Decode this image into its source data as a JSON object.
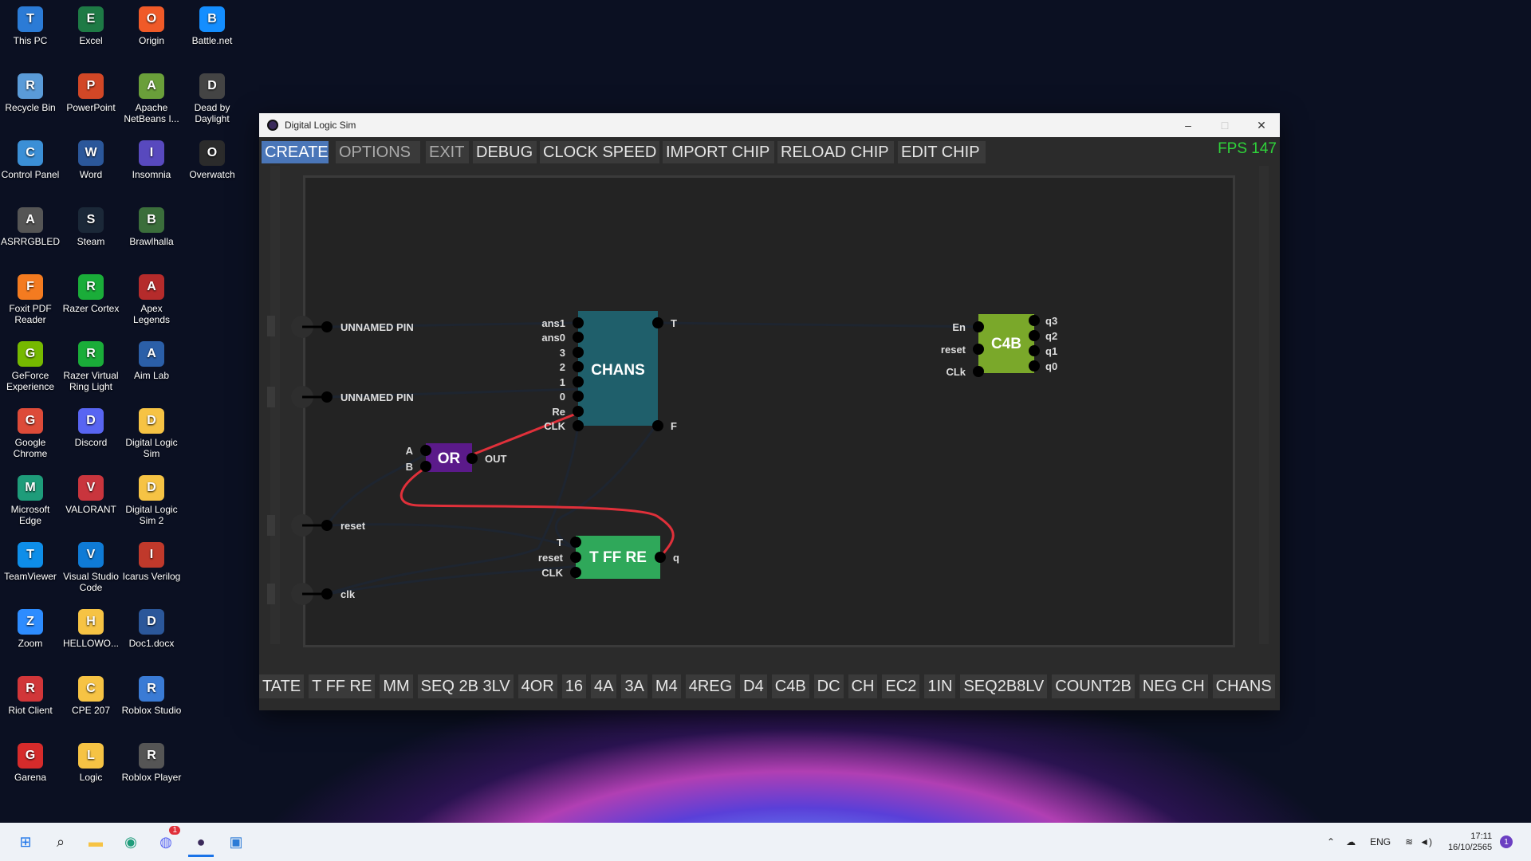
{
  "desktop": {
    "icons": [
      {
        "label": "This PC",
        "icon": "monitor-icon",
        "color": "#2b7bd6"
      },
      {
        "label": "Excel",
        "icon": "excel-icon",
        "color": "#1e7a45"
      },
      {
        "label": "Origin",
        "icon": "origin-icon",
        "color": "#f05a28"
      },
      {
        "label": "Battle.net",
        "icon": "battlenet-icon",
        "color": "#148eff"
      },
      {
        "label": "Recycle Bin",
        "icon": "recycle-bin-icon",
        "color": "#5a9bd8"
      },
      {
        "label": "PowerPoint",
        "icon": "powerpoint-icon",
        "color": "#d24726"
      },
      {
        "label": "Apache NetBeans I...",
        "icon": "netbeans-icon",
        "color": "#6a9f3a"
      },
      {
        "label": "Dead by Daylight",
        "icon": "dbd-icon",
        "color": "#444444"
      },
      {
        "label": "Control Panel",
        "icon": "control-panel-icon",
        "color": "#3b8fd6"
      },
      {
        "label": "Word",
        "icon": "word-icon",
        "color": "#2b579a"
      },
      {
        "label": "Insomnia",
        "icon": "insomnia-icon",
        "color": "#5849be"
      },
      {
        "label": "Overwatch",
        "icon": "overwatch-icon",
        "color": "#2b2b2b"
      },
      {
        "label": "ASRRGBLED",
        "icon": "asrock-icon",
        "color": "#555555"
      },
      {
        "label": "Steam",
        "icon": "steam-icon",
        "color": "#1b2838"
      },
      {
        "label": "Brawlhalla",
        "icon": "brawlhalla-icon",
        "color": "#3b6e3b"
      },
      {
        "label": "",
        "icon": "",
        "color": ""
      },
      {
        "label": "Foxit PDF Reader",
        "icon": "foxit-icon",
        "color": "#f47b20"
      },
      {
        "label": "Razer Cortex",
        "icon": "razer-cortex-icon",
        "color": "#1aad39"
      },
      {
        "label": "Apex Legends",
        "icon": "apex-icon",
        "color": "#b52b2b"
      },
      {
        "label": "",
        "icon": "",
        "color": ""
      },
      {
        "label": "GeForce Experience",
        "icon": "geforce-icon",
        "color": "#76b900"
      },
      {
        "label": "Razer Virtual Ring Light",
        "icon": "razer-ring-icon",
        "color": "#1aad39"
      },
      {
        "label": "Aim Lab",
        "icon": "aimlab-icon",
        "color": "#2b5fa8"
      },
      {
        "label": "",
        "icon": "",
        "color": ""
      },
      {
        "label": "Google Chrome",
        "icon": "chrome-icon",
        "color": "#dd4b39"
      },
      {
        "label": "Discord",
        "icon": "discord-icon",
        "color": "#5865f2"
      },
      {
        "label": "Digital Logic Sim",
        "icon": "folder-icon",
        "color": "#f6c344"
      },
      {
        "label": "",
        "icon": "",
        "color": ""
      },
      {
        "label": "Microsoft Edge",
        "icon": "edge-icon",
        "color": "#1e9c7a"
      },
      {
        "label": "VALORANT",
        "icon": "valorant-icon",
        "color": "#c9353d"
      },
      {
        "label": "Digital Logic Sim 2",
        "icon": "folder-icon",
        "color": "#f6c344"
      },
      {
        "label": "",
        "icon": "",
        "color": ""
      },
      {
        "label": "TeamViewer",
        "icon": "teamviewer-icon",
        "color": "#0e8ee9"
      },
      {
        "label": "Visual Studio Code",
        "icon": "vscode-icon",
        "color": "#0f7bd6"
      },
      {
        "label": "Icarus Verilog",
        "icon": "icarus-icon",
        "color": "#c0392b"
      },
      {
        "label": "",
        "icon": "",
        "color": ""
      },
      {
        "label": "Zoom",
        "icon": "zoom-icon",
        "color": "#2d8cff"
      },
      {
        "label": "HELLOWO...",
        "icon": "folder-icon",
        "color": "#f6c344"
      },
      {
        "label": "Doc1.docx",
        "icon": "docx-icon",
        "color": "#2b579a"
      },
      {
        "label": "",
        "icon": "",
        "color": ""
      },
      {
        "label": "Riot Client",
        "icon": "riot-icon",
        "color": "#d13639"
      },
      {
        "label": "CPE 207",
        "icon": "folder-icon",
        "color": "#f6c344"
      },
      {
        "label": "Roblox Studio",
        "icon": "roblox-studio-icon",
        "color": "#3a7bd5"
      },
      {
        "label": "",
        "icon": "",
        "color": ""
      },
      {
        "label": "Garena",
        "icon": "garena-icon",
        "color": "#d62b2b"
      },
      {
        "label": "Logic",
        "icon": "folder-icon",
        "color": "#f6c344"
      },
      {
        "label": "Roblox Player",
        "icon": "roblox-icon",
        "color": "#555555"
      }
    ]
  },
  "window": {
    "title": "Digital Logic Sim",
    "minimize": "–",
    "maximize": "□",
    "close": "✕"
  },
  "menu": {
    "items": [
      "CREATE",
      "OPTIONS",
      "EXIT",
      "DEBUG",
      "CLOCK SPEED",
      "IMPORT CHIP",
      "RELOAD CHIP",
      "EDIT CHIP"
    ],
    "fps": "FPS 147",
    "fps_color": "#2fd23a"
  },
  "circuit": {
    "inputs": [
      "UNNAMED PIN",
      "UNNAMED PIN",
      "reset",
      "clk"
    ],
    "chans": {
      "name": "CHANS",
      "color": "#1f5f6b",
      "inputs": [
        "ans1",
        "ans0",
        "3",
        "2",
        "1",
        "0",
        "Re",
        "CLK"
      ],
      "outputs": [
        "T",
        "F"
      ]
    },
    "c4b": {
      "name": "C4B",
      "color": "#7aa82a",
      "inputs": [
        "En",
        "reset",
        "CLk"
      ],
      "outputs": [
        "q3",
        "q2",
        "q1",
        "q0"
      ]
    },
    "or": {
      "name": "OR",
      "color": "#5b1a8a",
      "inputs": [
        "A",
        "B"
      ],
      "outputs": [
        "OUT"
      ]
    },
    "tff": {
      "name": "T FF RE",
      "color": "#2fa85a",
      "inputs": [
        "T",
        "reset",
        "CLK"
      ],
      "outputs": [
        "q"
      ]
    },
    "wire_on_color": "#e0303a",
    "wire_off_color": "#1e2530"
  },
  "chips": [
    "TATE",
    "T FF RE",
    "MM",
    "SEQ 2B 3LV",
    "4OR",
    "16",
    "4A",
    "3A",
    "M4",
    "4REG",
    "D4",
    "C4B",
    "DC",
    "CH",
    "EC2",
    "1IN",
    "SEQ2B8LV",
    "COUNT2B",
    "NEG CH",
    "CHANS"
  ],
  "taskbar": {
    "apps": [
      "windows-start-icon",
      "search-icon",
      "file-explorer-icon",
      "edge-icon",
      "discord-icon",
      "digital-logic-sim-icon",
      "photos-icon"
    ],
    "discord_badge": "1",
    "lang": "ENG",
    "time": "17:11",
    "date": "16/10/2565",
    "notification_count": "1"
  }
}
